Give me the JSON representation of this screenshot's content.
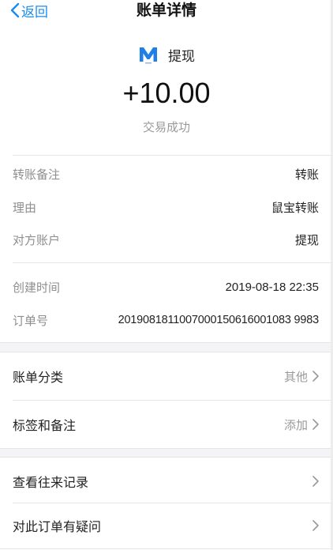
{
  "nav": {
    "back_label": "返回",
    "title": "账单详情"
  },
  "merchant": {
    "name": "提现",
    "logo_icon": "m-brand-logo-icon",
    "logo_color": "#1f7fe6"
  },
  "amount": "+10.00",
  "status": "交易成功",
  "details": [
    {
      "label": "转账备注",
      "value": "转账"
    },
    {
      "label": "理由",
      "value": "鼠宝转账"
    },
    {
      "label": "对方账户",
      "value": "提现"
    }
  ],
  "details2": [
    {
      "label": "创建时间",
      "value": "2019-08-18 22:35"
    },
    {
      "label": "订单号",
      "value": "2019081811007000150616001083 9983"
    }
  ],
  "category": {
    "label": "账单分类",
    "value": "其他"
  },
  "tags": {
    "label": "标签和备注",
    "value": "添加"
  },
  "history": {
    "label": "查看往来记录"
  },
  "question": {
    "label": "对此订单有疑问"
  },
  "colors": {
    "accent": "#1a8cf0",
    "section_bg": "#f4f4f6"
  }
}
